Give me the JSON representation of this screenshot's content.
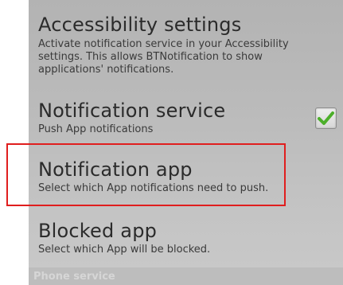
{
  "accessibility": {
    "title": "Accessibility settings",
    "description": "Activate notification service in your Accessibility settings. This allows BTNotification to show applications' notifications."
  },
  "notification_service": {
    "title": "Notification service",
    "subtitle": "Push App notifications",
    "checked": true
  },
  "notification_app": {
    "title": "Notification app",
    "subtitle": "Select which App notifications need to push."
  },
  "blocked_app": {
    "title": "Blocked app",
    "subtitle": "Select which App will be blocked."
  },
  "footer": {
    "section_label": "Phone service"
  },
  "colors": {
    "highlight": "#e01e1e",
    "checkmark": "#4caf2a"
  },
  "icons": {
    "checkbox": "checkmark-icon"
  }
}
